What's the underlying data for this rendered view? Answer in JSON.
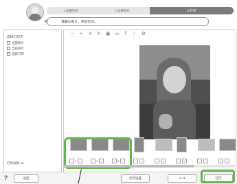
{
  "header": {
    "steps": [
      "1.设置打印",
      "2.选择照片",
      "3.打印"
    ],
    "active_step": 2,
    "instruction": "请确认照片，然后打印。"
  },
  "left_panel": {
    "title": "选择打印页",
    "options": [
      "全部照片",
      "当前照片",
      "选择打印"
    ],
    "selected_option": 0,
    "count_label": "打印总数: 11"
  },
  "toolbar": {
    "icons": [
      "zoom-out-icon",
      "zoom-in-icon",
      "rotate-left-icon",
      "rotate-right-icon",
      "fit-icon",
      "frame-icon",
      "text-icon",
      "edit-icon",
      "settings-icon"
    ],
    "glyphs": [
      "−",
      "+",
      "↺",
      "↻",
      "▣",
      "▭",
      "T",
      "⁄",
      "⚙"
    ]
  },
  "thumbnails": {
    "items": [
      {
        "qty": "1",
        "light": false,
        "portrait": false
      },
      {
        "qty": "1",
        "light": false,
        "portrait": false
      },
      {
        "qty": "1",
        "light": false,
        "portrait": false
      },
      {
        "qty": "",
        "light": false,
        "portrait": true
      },
      {
        "qty": "",
        "light": true,
        "portrait": false
      },
      {
        "qty": "",
        "light": false,
        "portrait": true
      },
      {
        "qty": "",
        "light": true,
        "portrait": false
      },
      {
        "qty": "",
        "light": false,
        "portrait": false
      }
    ]
  },
  "footer": {
    "help_label": "?",
    "back_label": "返回",
    "settings_label": "打印设置",
    "page_label": "1 / 3",
    "print_label": "打印"
  },
  "colors": {
    "highlight": "#5fba46",
    "step_active": "#7b7b7b"
  }
}
